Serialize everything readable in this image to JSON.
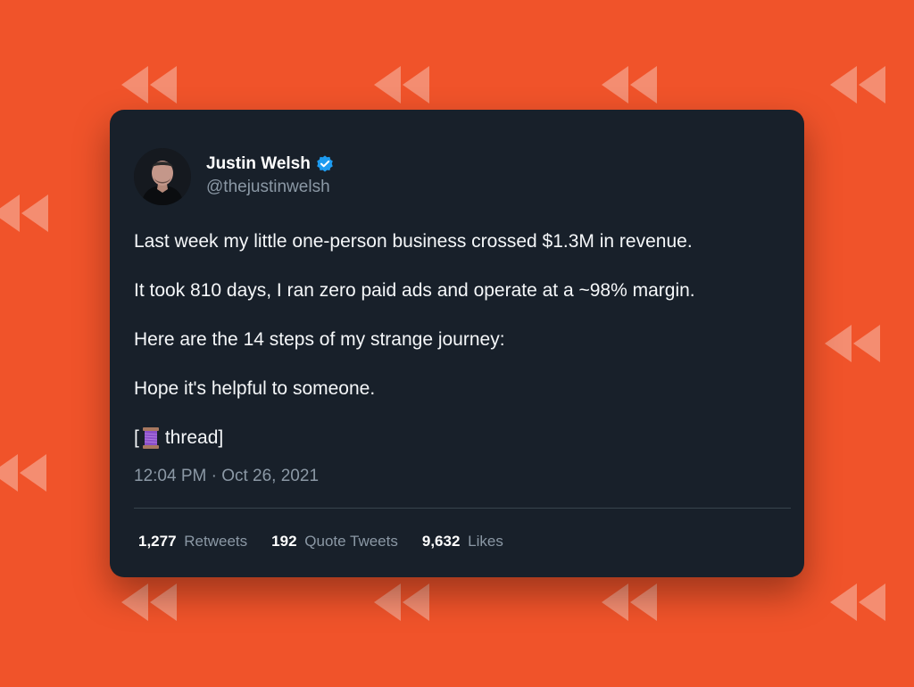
{
  "background": {
    "color": "#f0532a",
    "pattern_icon": "rewind-icon"
  },
  "tweet": {
    "author": {
      "name": "Justin Welsh",
      "handle": "@thejustinwelsh",
      "verified_icon": "verified-badge-icon",
      "avatar_icon": "avatar"
    },
    "lines": [
      "Last week my little one-person business crossed $1.3M in revenue.",
      "It took 810 days, I ran zero paid ads and operate at a ~98% margin.",
      "Here are the 14 steps of my strange journey:",
      "Hope it's helpful to someone."
    ],
    "thread": {
      "open": "[",
      "icon": "spool-of-thread-icon",
      "label": "thread]"
    },
    "timestamp": "12:04 PM · Oct 26, 2021",
    "stats": {
      "retweets": {
        "count": "1,277",
        "label": "Retweets"
      },
      "quotes": {
        "count": "192",
        "label": "Quote Tweets"
      },
      "likes": {
        "count": "9,632",
        "label": "Likes"
      }
    }
  },
  "colors": {
    "card": "#18202a",
    "text": "#f5f7f9",
    "muted": "#8b98a5",
    "verified": "#1d9bf0",
    "divider": "#38444d"
  }
}
